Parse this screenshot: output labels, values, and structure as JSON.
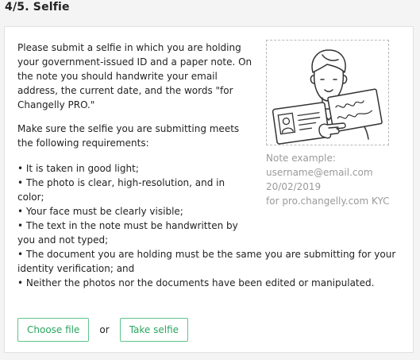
{
  "step": {
    "title": "4/5. Selfie"
  },
  "instructions": {
    "paragraph1": "Please submit a selfie in which you are holding your government-issued ID and a paper note. On the note you should handwrite your email address, the current date, and the words \"for Changelly PRO.\"",
    "paragraph2": "Make sure the selfie you are submitting meets the following requirements:"
  },
  "requirements": [
    "• It is taken in good light;",
    "• The photo is clear, high-resolution, and in color;",
    "• Your face must be clearly visible;",
    "• The text in the note must be handwritten by you and not typed;",
    "• The document you are holding must be the same you are submitting for your identity verification; and",
    "• Neither the photos nor the documents have been edited or manipulated."
  ],
  "note_example": {
    "heading": "Note example:",
    "email": "username@email.com",
    "date": "20/02/2019",
    "text": "for pro.changelly.com KYC"
  },
  "actions": {
    "choose_file_label": "Choose file",
    "or_label": "or",
    "take_selfie_label": "Take selfie"
  },
  "colors": {
    "accent": "#2aa55f",
    "accent_border": "#5fc48b",
    "muted_text": "#9a9a9a",
    "page_bg": "#f4f4f4",
    "card_border": "#e1e1e1"
  },
  "icons": {
    "illustration": "person-holding-id-and-note-illustration"
  }
}
